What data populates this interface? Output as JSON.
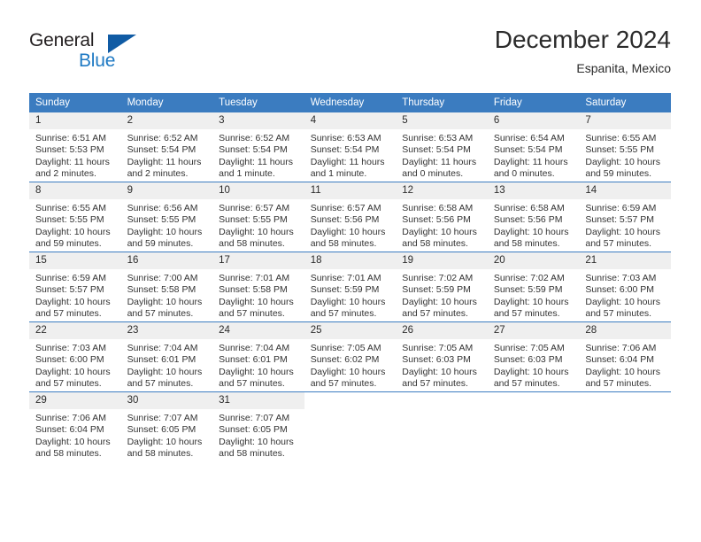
{
  "brand": {
    "name_part1": "General",
    "name_part2": "Blue",
    "triangle_color": "#105ba4",
    "blue_color": "#1f7ac4"
  },
  "header": {
    "title": "December 2024",
    "subtitle": "Espanita, Mexico"
  },
  "theme": {
    "header_bg": "#3b7cc0",
    "daynum_bg": "#efefef",
    "text": "#2b2b2b"
  },
  "weekdays": [
    "Sunday",
    "Monday",
    "Tuesday",
    "Wednesday",
    "Thursday",
    "Friday",
    "Saturday"
  ],
  "weeks": [
    [
      {
        "day": "1",
        "sunrise": "Sunrise: 6:51 AM",
        "sunset": "Sunset: 5:53 PM",
        "daylight_1": "Daylight: 11 hours",
        "daylight_2": "and 2 minutes."
      },
      {
        "day": "2",
        "sunrise": "Sunrise: 6:52 AM",
        "sunset": "Sunset: 5:54 PM",
        "daylight_1": "Daylight: 11 hours",
        "daylight_2": "and 2 minutes."
      },
      {
        "day": "3",
        "sunrise": "Sunrise: 6:52 AM",
        "sunset": "Sunset: 5:54 PM",
        "daylight_1": "Daylight: 11 hours",
        "daylight_2": "and 1 minute."
      },
      {
        "day": "4",
        "sunrise": "Sunrise: 6:53 AM",
        "sunset": "Sunset: 5:54 PM",
        "daylight_1": "Daylight: 11 hours",
        "daylight_2": "and 1 minute."
      },
      {
        "day": "5",
        "sunrise": "Sunrise: 6:53 AM",
        "sunset": "Sunset: 5:54 PM",
        "daylight_1": "Daylight: 11 hours",
        "daylight_2": "and 0 minutes."
      },
      {
        "day": "6",
        "sunrise": "Sunrise: 6:54 AM",
        "sunset": "Sunset: 5:54 PM",
        "daylight_1": "Daylight: 11 hours",
        "daylight_2": "and 0 minutes."
      },
      {
        "day": "7",
        "sunrise": "Sunrise: 6:55 AM",
        "sunset": "Sunset: 5:55 PM",
        "daylight_1": "Daylight: 10 hours",
        "daylight_2": "and 59 minutes."
      }
    ],
    [
      {
        "day": "8",
        "sunrise": "Sunrise: 6:55 AM",
        "sunset": "Sunset: 5:55 PM",
        "daylight_1": "Daylight: 10 hours",
        "daylight_2": "and 59 minutes."
      },
      {
        "day": "9",
        "sunrise": "Sunrise: 6:56 AM",
        "sunset": "Sunset: 5:55 PM",
        "daylight_1": "Daylight: 10 hours",
        "daylight_2": "and 59 minutes."
      },
      {
        "day": "10",
        "sunrise": "Sunrise: 6:57 AM",
        "sunset": "Sunset: 5:55 PM",
        "daylight_1": "Daylight: 10 hours",
        "daylight_2": "and 58 minutes."
      },
      {
        "day": "11",
        "sunrise": "Sunrise: 6:57 AM",
        "sunset": "Sunset: 5:56 PM",
        "daylight_1": "Daylight: 10 hours",
        "daylight_2": "and 58 minutes."
      },
      {
        "day": "12",
        "sunrise": "Sunrise: 6:58 AM",
        "sunset": "Sunset: 5:56 PM",
        "daylight_1": "Daylight: 10 hours",
        "daylight_2": "and 58 minutes."
      },
      {
        "day": "13",
        "sunrise": "Sunrise: 6:58 AM",
        "sunset": "Sunset: 5:56 PM",
        "daylight_1": "Daylight: 10 hours",
        "daylight_2": "and 58 minutes."
      },
      {
        "day": "14",
        "sunrise": "Sunrise: 6:59 AM",
        "sunset": "Sunset: 5:57 PM",
        "daylight_1": "Daylight: 10 hours",
        "daylight_2": "and 57 minutes."
      }
    ],
    [
      {
        "day": "15",
        "sunrise": "Sunrise: 6:59 AM",
        "sunset": "Sunset: 5:57 PM",
        "daylight_1": "Daylight: 10 hours",
        "daylight_2": "and 57 minutes."
      },
      {
        "day": "16",
        "sunrise": "Sunrise: 7:00 AM",
        "sunset": "Sunset: 5:58 PM",
        "daylight_1": "Daylight: 10 hours",
        "daylight_2": "and 57 minutes."
      },
      {
        "day": "17",
        "sunrise": "Sunrise: 7:01 AM",
        "sunset": "Sunset: 5:58 PM",
        "daylight_1": "Daylight: 10 hours",
        "daylight_2": "and 57 minutes."
      },
      {
        "day": "18",
        "sunrise": "Sunrise: 7:01 AM",
        "sunset": "Sunset: 5:59 PM",
        "daylight_1": "Daylight: 10 hours",
        "daylight_2": "and 57 minutes."
      },
      {
        "day": "19",
        "sunrise": "Sunrise: 7:02 AM",
        "sunset": "Sunset: 5:59 PM",
        "daylight_1": "Daylight: 10 hours",
        "daylight_2": "and 57 minutes."
      },
      {
        "day": "20",
        "sunrise": "Sunrise: 7:02 AM",
        "sunset": "Sunset: 5:59 PM",
        "daylight_1": "Daylight: 10 hours",
        "daylight_2": "and 57 minutes."
      },
      {
        "day": "21",
        "sunrise": "Sunrise: 7:03 AM",
        "sunset": "Sunset: 6:00 PM",
        "daylight_1": "Daylight: 10 hours",
        "daylight_2": "and 57 minutes."
      }
    ],
    [
      {
        "day": "22",
        "sunrise": "Sunrise: 7:03 AM",
        "sunset": "Sunset: 6:00 PM",
        "daylight_1": "Daylight: 10 hours",
        "daylight_2": "and 57 minutes."
      },
      {
        "day": "23",
        "sunrise": "Sunrise: 7:04 AM",
        "sunset": "Sunset: 6:01 PM",
        "daylight_1": "Daylight: 10 hours",
        "daylight_2": "and 57 minutes."
      },
      {
        "day": "24",
        "sunrise": "Sunrise: 7:04 AM",
        "sunset": "Sunset: 6:01 PM",
        "daylight_1": "Daylight: 10 hours",
        "daylight_2": "and 57 minutes."
      },
      {
        "day": "25",
        "sunrise": "Sunrise: 7:05 AM",
        "sunset": "Sunset: 6:02 PM",
        "daylight_1": "Daylight: 10 hours",
        "daylight_2": "and 57 minutes."
      },
      {
        "day": "26",
        "sunrise": "Sunrise: 7:05 AM",
        "sunset": "Sunset: 6:03 PM",
        "daylight_1": "Daylight: 10 hours",
        "daylight_2": "and 57 minutes."
      },
      {
        "day": "27",
        "sunrise": "Sunrise: 7:05 AM",
        "sunset": "Sunset: 6:03 PM",
        "daylight_1": "Daylight: 10 hours",
        "daylight_2": "and 57 minutes."
      },
      {
        "day": "28",
        "sunrise": "Sunrise: 7:06 AM",
        "sunset": "Sunset: 6:04 PM",
        "daylight_1": "Daylight: 10 hours",
        "daylight_2": "and 57 minutes."
      }
    ],
    [
      {
        "day": "29",
        "sunrise": "Sunrise: 7:06 AM",
        "sunset": "Sunset: 6:04 PM",
        "daylight_1": "Daylight: 10 hours",
        "daylight_2": "and 58 minutes."
      },
      {
        "day": "30",
        "sunrise": "Sunrise: 7:07 AM",
        "sunset": "Sunset: 6:05 PM",
        "daylight_1": "Daylight: 10 hours",
        "daylight_2": "and 58 minutes."
      },
      {
        "day": "31",
        "sunrise": "Sunrise: 7:07 AM",
        "sunset": "Sunset: 6:05 PM",
        "daylight_1": "Daylight: 10 hours",
        "daylight_2": "and 58 minutes."
      },
      {
        "day": "",
        "sunrise": "",
        "sunset": "",
        "daylight_1": "",
        "daylight_2": ""
      },
      {
        "day": "",
        "sunrise": "",
        "sunset": "",
        "daylight_1": "",
        "daylight_2": ""
      },
      {
        "day": "",
        "sunrise": "",
        "sunset": "",
        "daylight_1": "",
        "daylight_2": ""
      },
      {
        "day": "",
        "sunrise": "",
        "sunset": "",
        "daylight_1": "",
        "daylight_2": ""
      }
    ]
  ]
}
